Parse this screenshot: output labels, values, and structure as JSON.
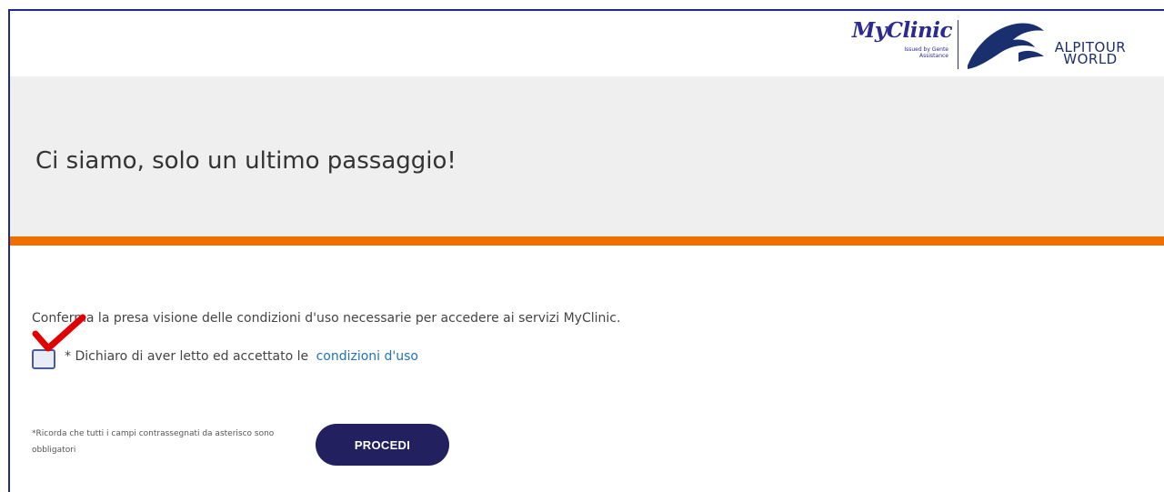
{
  "header": {
    "myclinic_logo_text": "MyClinic",
    "myclinic_logo_subtext": "Issued by Gente Assistance",
    "alpitour_line1": "ALPITOUR",
    "alpitour_line2": "WORLD"
  },
  "banner": {
    "title": "Ci siamo, solo un ultimo passaggio!"
  },
  "form": {
    "confirm_text": "Conferma la presa visione delle condizioni d'uso necessarie per accedere ai servizi MyClinic.",
    "checkbox_label": "* Dichiaro di aver letto ed accettato le",
    "checkbox_link": "condizioni d'uso",
    "checkbox_checked": true,
    "required_note": "*Ricorda che tutti i campi contrassegnati da asterisco sono obbligatori",
    "proceed_label": "PROCEDI"
  },
  "colors": {
    "accent_orange": "#ef6f00",
    "button_navy": "#23205f",
    "link_blue": "#1e73be",
    "annotation_red": "#e00000"
  }
}
